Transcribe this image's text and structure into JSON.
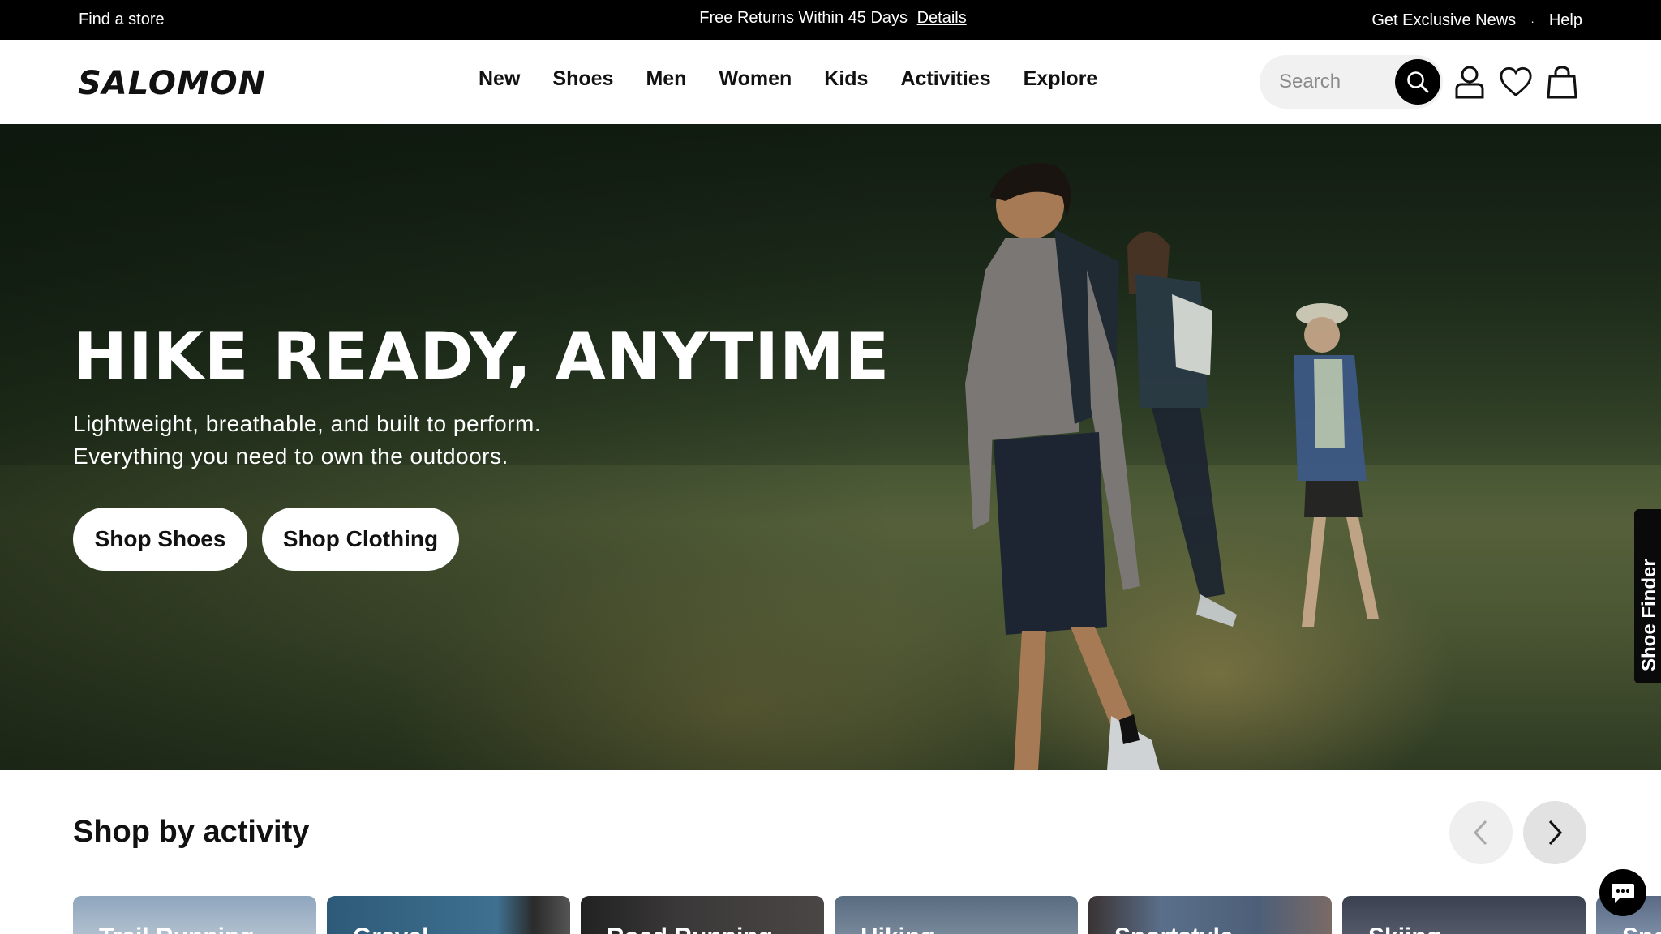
{
  "topbar": {
    "find_store": "Find a store",
    "promo": "Free Returns Within 45 Days",
    "details": "Details",
    "exclusive": "Get Exclusive News",
    "separator": "·",
    "help": "Help"
  },
  "header": {
    "logo": "SALOMON",
    "nav": [
      "New",
      "Shoes",
      "Men",
      "Women",
      "Kids",
      "Activities",
      "Explore"
    ],
    "search_placeholder": "Search",
    "icons": [
      "search-icon",
      "account-icon",
      "wishlist-heart-icon",
      "shopping-bag-icon"
    ]
  },
  "hero": {
    "title": "HIKE READY, ANYTIME",
    "subtitle_line1": "Lightweight, breathable, and built to perform.",
    "subtitle_line2": "Everything you need to own the outdoors.",
    "btn_shoes": "Shop Shoes",
    "btn_clothing": "Shop Clothing",
    "shoe_finder": "Shoe Finder"
  },
  "activity": {
    "title": "Shop by activity",
    "cards": [
      "Trail Running",
      "Gravel",
      "Road Running",
      "Hiking",
      "Sportstyle",
      "Skiing",
      "Sno"
    ]
  },
  "colors": {
    "topbar_bg": "#000000",
    "accent": "#111111",
    "button_bg": "#ffffff"
  }
}
